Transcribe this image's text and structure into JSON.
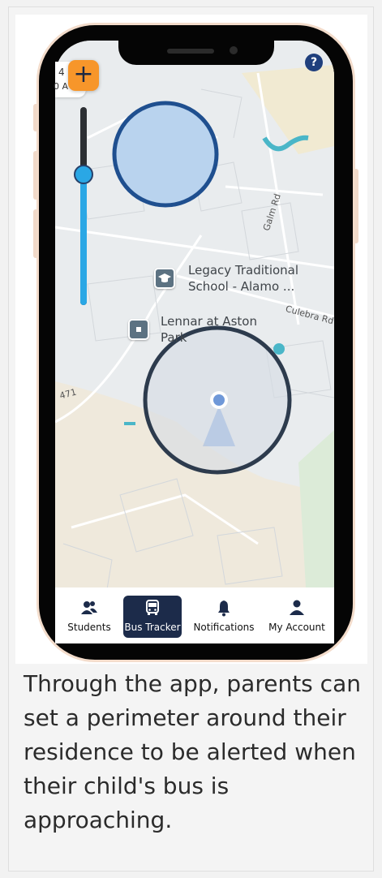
{
  "map": {
    "poi_school_line1": "Legacy Traditional",
    "poi_school_line2": "School - Alamo ...",
    "poi_lennar_line1": "Lennar at Aston",
    "poi_lennar_line2": "Park",
    "road_galm": "Galm Rd",
    "road_culebra": "Culebra Rd",
    "road_471": "471",
    "time_top": "4",
    "time_bottom": "0 A",
    "help_label": "?",
    "add_label": "+"
  },
  "slider": {
    "level": 0.66,
    "accent": "#2aa7e5"
  },
  "nav": {
    "items": [
      {
        "label": "Students",
        "icon": "students-icon"
      },
      {
        "label": "Bus Tracker",
        "icon": "bus-icon",
        "active": true
      },
      {
        "label": "Notifications",
        "icon": "bell-icon"
      },
      {
        "label": "My Account",
        "icon": "user-icon"
      }
    ]
  },
  "caption": "Through the app, parents can set a perimeter around their residence to be alerted when their child's bus is approaching.",
  "colors": {
    "accent_orange": "#f7962a",
    "navy": "#1c2b4a",
    "perimeter_blue": "#1f4f8f"
  }
}
